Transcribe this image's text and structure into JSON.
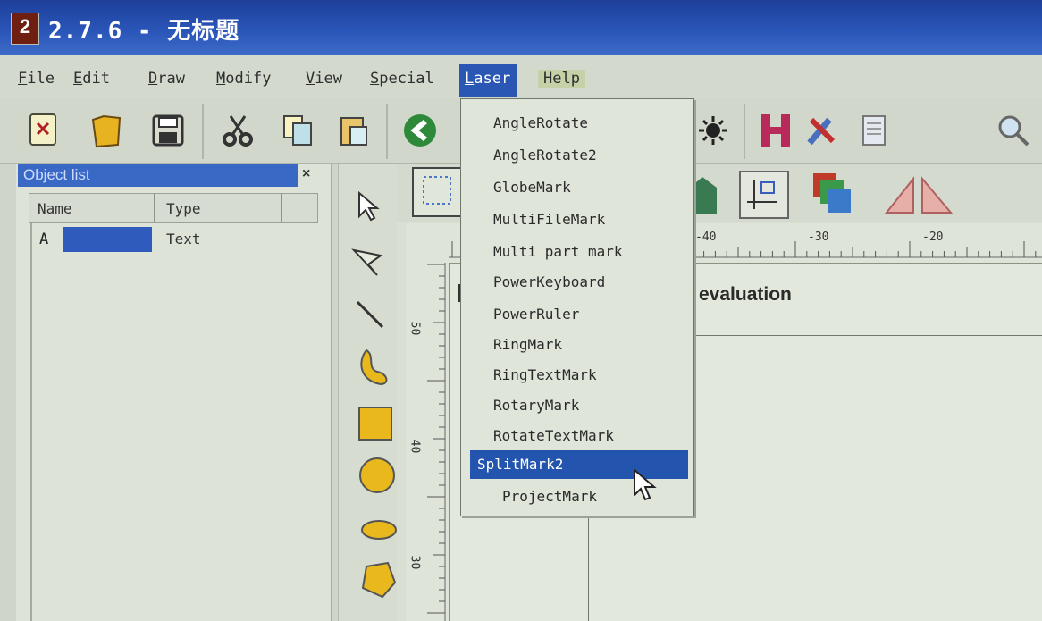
{
  "window": {
    "icon_text": "2",
    "title": "2.7.6 - 无标题"
  },
  "menubar": {
    "items": [
      {
        "label": "File",
        "accel": "F",
        "rest": "ile"
      },
      {
        "label": "Edit",
        "accel": "E",
        "rest": "dit"
      },
      {
        "label": "Draw",
        "accel": "D",
        "rest": "raw"
      },
      {
        "label": "Modify",
        "accel": "M",
        "rest": "odify"
      },
      {
        "label": "View",
        "accel": "V",
        "rest": "iew"
      },
      {
        "label": "Special",
        "accel": "S",
        "rest": "pecial"
      },
      {
        "label": "Laser",
        "accel": "L",
        "rest": "aser"
      },
      {
        "label": "Help",
        "accel": "",
        "rest": "Help"
      }
    ],
    "active": "Laser"
  },
  "object_list": {
    "title": "Object list",
    "close_glyph": "×",
    "columns": [
      "Name",
      "Type"
    ],
    "rows": [
      {
        "name": "A",
        "type": "Text"
      }
    ]
  },
  "canvas": {
    "ruler_h_ticks": [
      "-40",
      "-30",
      "-20"
    ],
    "ruler_v_ticks": [
      "50",
      "40",
      "30"
    ],
    "partial_text": "r evaluation"
  },
  "laser_menu": {
    "items": [
      "AngleRotate",
      "AngleRotate2",
      "GlobeMark",
      "MultiFileMark",
      "Multi part mark",
      "PowerKeyboard",
      "PowerRuler",
      "RingMark",
      "RingTextMark",
      "RotaryMark",
      "RotateTextMark",
      "SplitMark2",
      "ProjectMark"
    ],
    "selected": "SplitMark2"
  },
  "colors": {
    "titlebar": "#2a55b8",
    "menu_highlight": "#2455ae",
    "panel_bg": "#dde3d7"
  }
}
